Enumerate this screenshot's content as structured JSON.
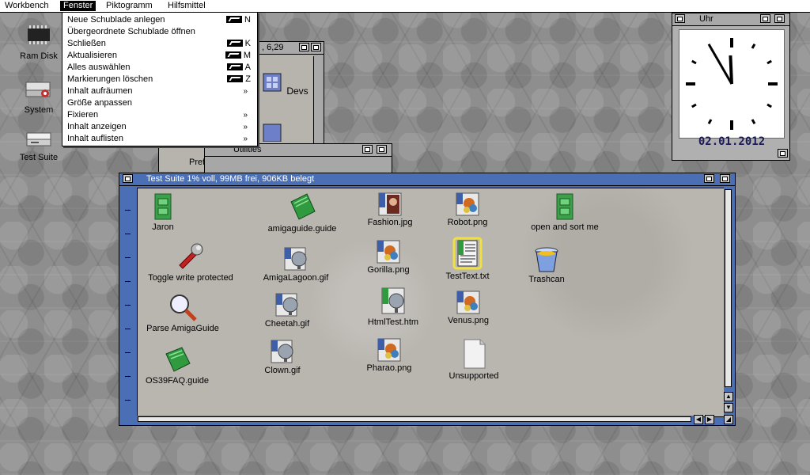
{
  "menubar": {
    "items": [
      "Workbench",
      "Fenster",
      "Piktogramm",
      "Hilfsmittel"
    ],
    "active": "Fenster"
  },
  "menu": {
    "items": [
      {
        "label": "Neue Schublade anlegen",
        "key": "N"
      },
      {
        "label": "Übergeordnete Schublade öffnen",
        "key": ""
      },
      {
        "label": "Schließen",
        "key": "K"
      },
      {
        "label": "Aktualisieren",
        "key": "M"
      },
      {
        "label": "Alles auswählen",
        "key": "A"
      },
      {
        "label": "Markierungen löschen",
        "key": "Z"
      },
      {
        "label": "Inhalt aufräumen",
        "submenu": "»"
      },
      {
        "label": "Größe anpassen",
        "key": ""
      },
      {
        "label": "Fixieren",
        "submenu": "»"
      },
      {
        "label": "Inhalt anzeigen",
        "submenu": "»"
      },
      {
        "label": "Inhalt auflisten",
        "submenu": "»"
      }
    ]
  },
  "desktop": {
    "icons": [
      {
        "label": "Ram Disk",
        "icon": "ram-chip-icon"
      },
      {
        "label": "System",
        "icon": "hard-drive-icon"
      },
      {
        "label": "Test Suite",
        "icon": "disk-drive-icon"
      }
    ]
  },
  "background_windows": {
    "partial_title": ", 6,29",
    "devs_label": "Devs",
    "prefs_partial": "Pref",
    "utilities_title": "Utilities"
  },
  "test_suite": {
    "title": "Test Suite  1% voll, 99MB frei, 906KB belegt",
    "icons": [
      {
        "label": "Jaron",
        "icon": "green-drawer-icon"
      },
      {
        "label": "Toggle write protected",
        "icon": "wrench-icon"
      },
      {
        "label": "Parse AmigaGuide",
        "icon": "magnifier-icon"
      },
      {
        "label": "OS39FAQ.guide",
        "icon": "guide-book-icon"
      },
      {
        "label": "amigaguide.guide",
        "icon": "guide-book-icon"
      },
      {
        "label": "AmigaLagoon.gif",
        "icon": "gif-file-icon",
        "badge": "GIF"
      },
      {
        "label": "Cheetah.gif",
        "icon": "gif-file-icon",
        "badge": "GIF"
      },
      {
        "label": "Clown.gif",
        "icon": "gif-file-icon",
        "badge": "GIF"
      },
      {
        "label": "Fashion.jpg",
        "icon": "jpeg-file-icon",
        "badge": "JPEG"
      },
      {
        "label": "Gorilla.png",
        "icon": "png-file-icon",
        "badge": "PNG"
      },
      {
        "label": "HtmlTest.htm",
        "icon": "html-file-icon",
        "badge": "HTML"
      },
      {
        "label": "Pharao.png",
        "icon": "png-file-icon",
        "badge": "PNG"
      },
      {
        "label": "Robot.png",
        "icon": "png-file-icon",
        "badge": "PNG"
      },
      {
        "label": "TestText.txt",
        "icon": "text-file-icon",
        "badge": "TEXT"
      },
      {
        "label": "Venus.png",
        "icon": "png-file-icon",
        "badge": "PNG"
      },
      {
        "label": "Unsupported",
        "icon": "blank-file-icon"
      },
      {
        "label": "open and sort me",
        "icon": "green-drawer-icon"
      },
      {
        "label": "Trashcan",
        "icon": "trashcan-icon"
      }
    ]
  },
  "clock": {
    "title": "Uhr",
    "date": "02.01.2012",
    "hour": 11,
    "minute": 55
  },
  "colors": {
    "active_window": "#4a6fb5",
    "drawer_green": "#3aa04a",
    "menu_bg": "#ffffff"
  }
}
